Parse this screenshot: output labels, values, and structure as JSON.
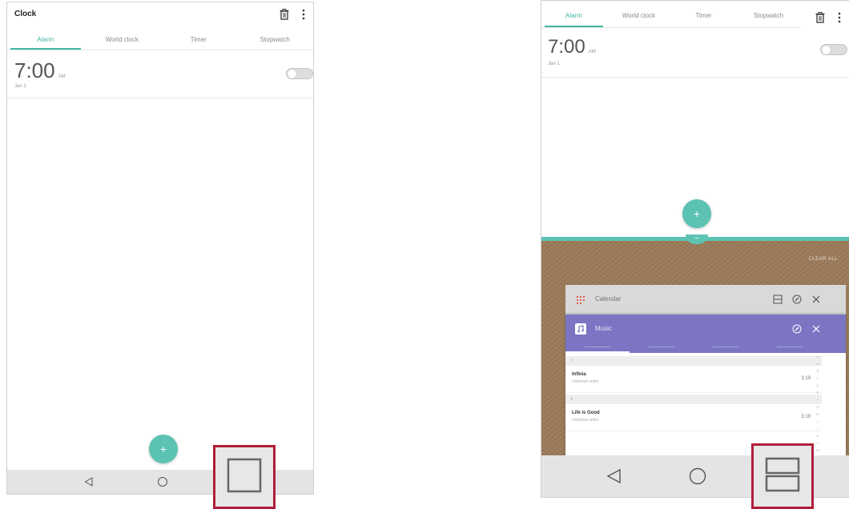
{
  "left": {
    "app_title": "Clock",
    "tabs": [
      {
        "label": "Alarm",
        "active": true
      },
      {
        "label": "World clock",
        "active": false
      },
      {
        "label": "Timer",
        "active": false
      },
      {
        "label": "Stopwatch",
        "active": false
      }
    ],
    "alarm": {
      "time": "7:00",
      "ampm": "AM",
      "date": "Jan 1",
      "enabled": false
    },
    "fab_label": "+"
  },
  "right": {
    "tabs": [
      {
        "label": "Alarm",
        "active": true
      },
      {
        "label": "World clock",
        "active": false
      },
      {
        "label": "Timer",
        "active": false
      },
      {
        "label": "Stopwatch",
        "active": false
      }
    ],
    "alarm": {
      "time": "7:00",
      "ampm": "AM",
      "date": "Jan 1",
      "enabled": false
    },
    "fab_label": "+",
    "divider_label": "–",
    "recents": {
      "clear_all": "CLEAR ALL",
      "calendar_card": {
        "title": "Calendar"
      },
      "music_card": {
        "title": "Music",
        "section_1": "I",
        "section_2": "L",
        "songs": [
          {
            "title": "Infinia",
            "artist": "Unknown artist",
            "duration": "3:19"
          },
          {
            "title": "Life is Good",
            "artist": "Unknown artist",
            "duration": "3:19"
          }
        ],
        "index_letters": [
          "#",
          "A",
          "B",
          "C",
          "D",
          "E",
          "F",
          "G",
          "H",
          "I",
          "J",
          "K",
          "L",
          "M",
          "N",
          "O"
        ]
      }
    }
  },
  "colors": {
    "accent": "#43b6a5",
    "fab": "#5cc3b2",
    "music_header": "#7b75c4",
    "highlight_border": "#b21d3a",
    "navbar": "#e4e4e4"
  },
  "icons": {
    "delete": "trash-icon",
    "more": "more-vert-icon",
    "back": "back-triangle-icon",
    "home": "home-circle-icon",
    "overview": "square-icon",
    "split": "split-screen-icon"
  }
}
